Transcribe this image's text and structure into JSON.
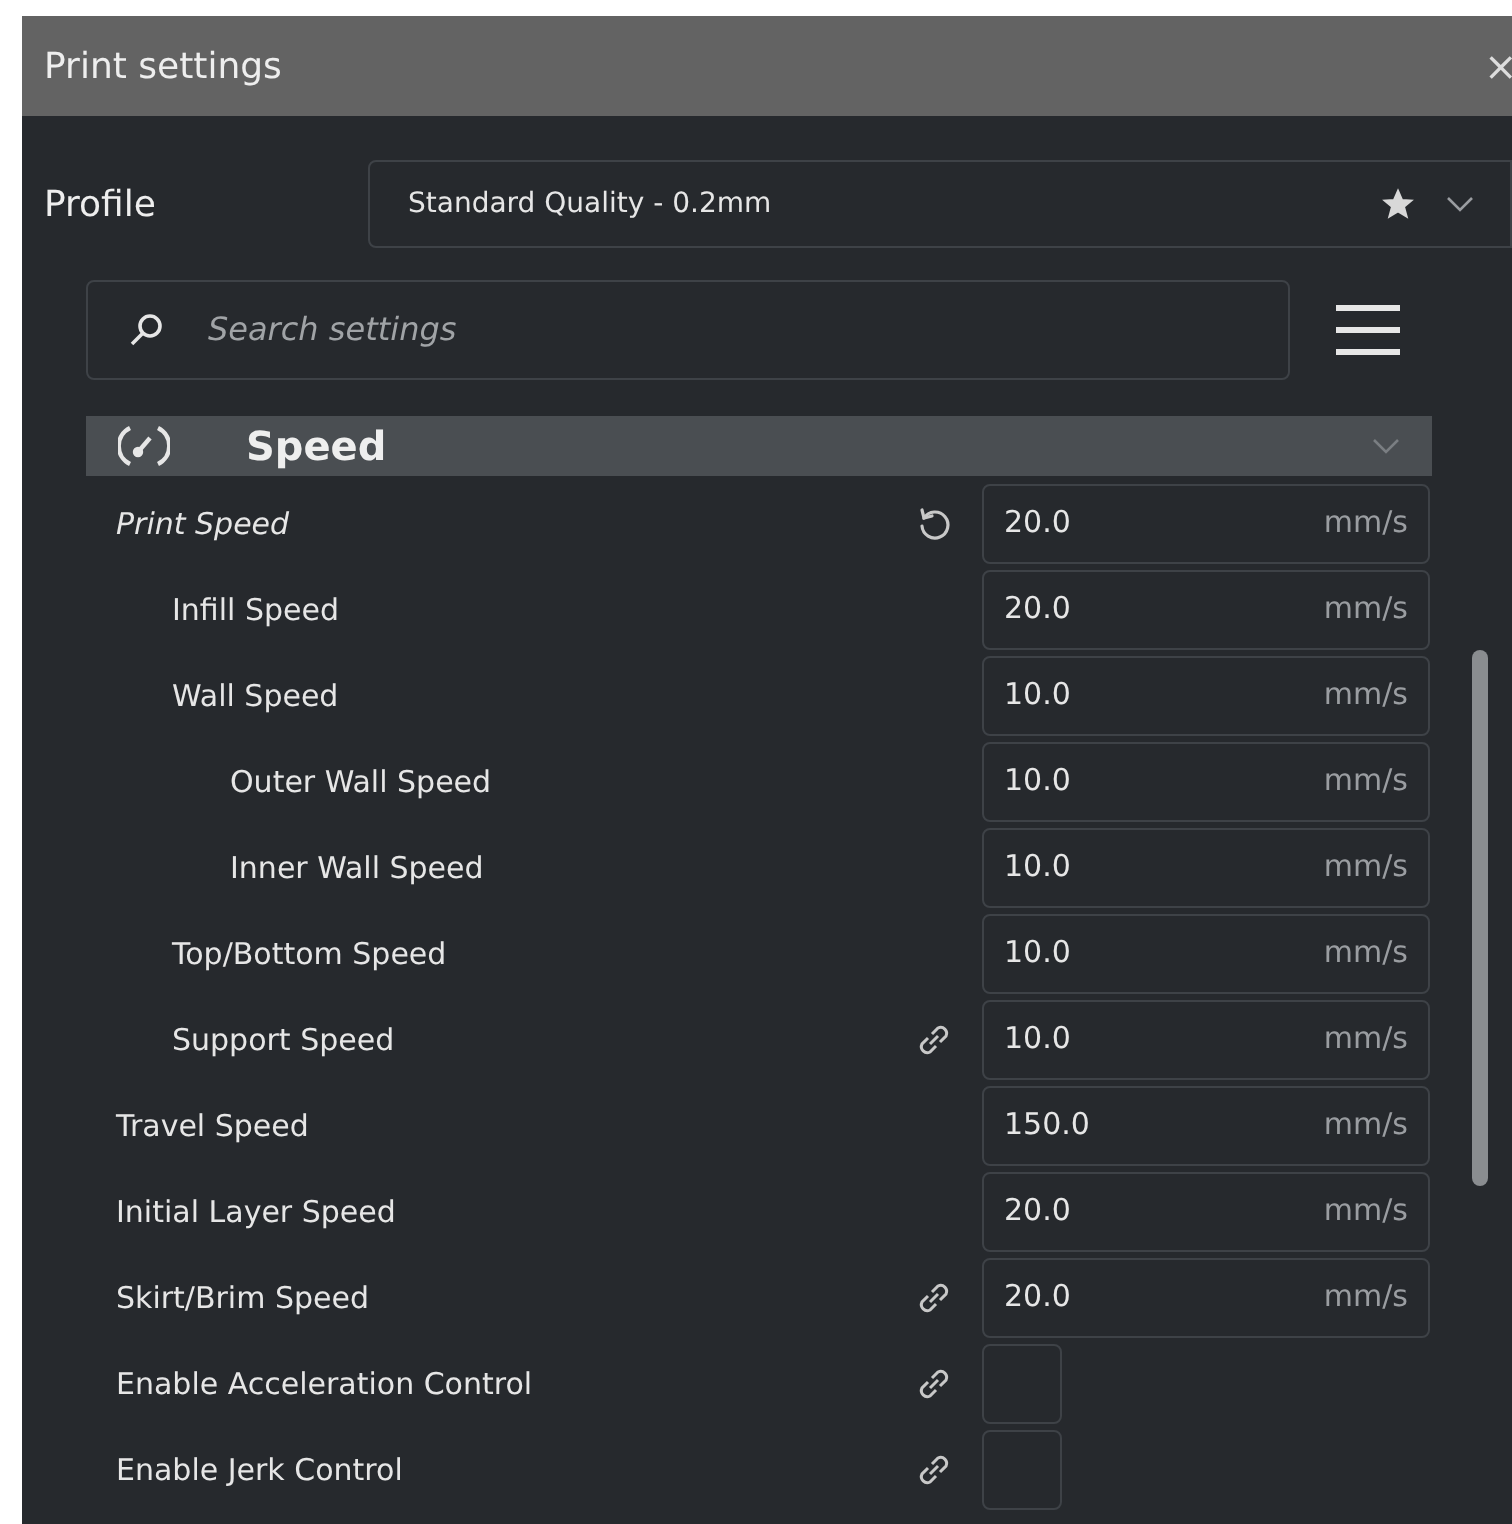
{
  "window": {
    "title": "Print settings",
    "close": "×"
  },
  "profile": {
    "label": "Profile",
    "value": "Standard Quality - 0.2mm",
    "favorite": true
  },
  "search": {
    "placeholder": "Search settings"
  },
  "category": {
    "title": "Speed",
    "expanded": true
  },
  "settings": [
    {
      "kind": "number",
      "label": "Print Speed",
      "overridden": true,
      "resettable": true,
      "linked": false,
      "value": "20.0",
      "unit": "mm/s",
      "children": [
        {
          "kind": "number",
          "label": "Infill Speed",
          "overridden": false,
          "resettable": false,
          "linked": false,
          "value": "20.0",
          "unit": "mm/s"
        },
        {
          "kind": "number",
          "label": "Wall Speed",
          "overridden": false,
          "resettable": false,
          "linked": false,
          "value": "10.0",
          "unit": "mm/s",
          "children": [
            {
              "kind": "number",
              "label": "Outer Wall Speed",
              "overridden": false,
              "resettable": false,
              "linked": false,
              "value": "10.0",
              "unit": "mm/s"
            },
            {
              "kind": "number",
              "label": "Inner Wall Speed",
              "overridden": false,
              "resettable": false,
              "linked": false,
              "value": "10.0",
              "unit": "mm/s"
            }
          ]
        },
        {
          "kind": "number",
          "label": "Top/Bottom Speed",
          "overridden": false,
          "resettable": false,
          "linked": false,
          "value": "10.0",
          "unit": "mm/s"
        },
        {
          "kind": "number",
          "label": "Support Speed",
          "overridden": false,
          "resettable": false,
          "linked": true,
          "value": "10.0",
          "unit": "mm/s"
        }
      ]
    },
    {
      "kind": "number",
      "label": "Travel Speed",
      "overridden": false,
      "resettable": false,
      "linked": false,
      "value": "150.0",
      "unit": "mm/s"
    },
    {
      "kind": "number",
      "label": "Initial Layer Speed",
      "overridden": false,
      "resettable": false,
      "linked": false,
      "value": "20.0",
      "unit": "mm/s"
    },
    {
      "kind": "number",
      "label": "Skirt/Brim Speed",
      "overridden": false,
      "resettable": false,
      "linked": true,
      "value": "20.0",
      "unit": "mm/s"
    },
    {
      "kind": "checkbox",
      "label": "Enable Acceleration Control",
      "overridden": false,
      "resettable": false,
      "linked": true,
      "checked": false
    },
    {
      "kind": "checkbox",
      "label": "Enable Jerk Control",
      "overridden": false,
      "resettable": false,
      "linked": true,
      "checked": false
    }
  ]
}
